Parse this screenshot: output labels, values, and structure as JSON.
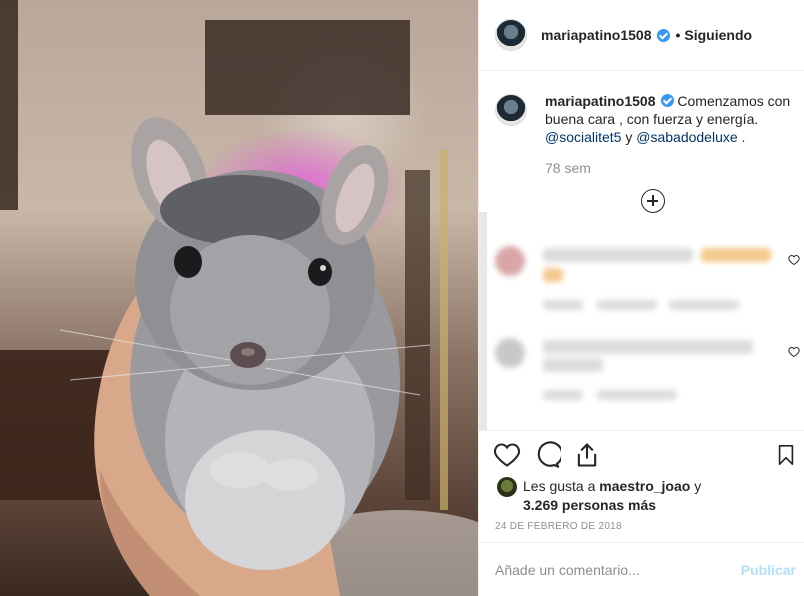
{
  "post": {
    "author": "mariapatino1508",
    "follow_separator": "•",
    "follow_status": "Siguiendo"
  },
  "caption": {
    "author": "mariapatino1508",
    "text_part1": "Comenzamos con buena cara , con fuerza y energía.",
    "mention1": "@socialitet5",
    "connector": " y ",
    "mention2": "@sabadodeluxe",
    "text_end": " .",
    "time_ago": "78 sem"
  },
  "likes": {
    "prefix": "Les gusta a ",
    "first_user": "maestro_joao",
    "connector": " y",
    "others": "3.269 personas más"
  },
  "date": "24 DE FEBRERO DE 2018",
  "comment_box": {
    "placeholder": "Añade un comentario...",
    "publish_label": "Publicar"
  },
  "icons": {
    "verified": "verified-badge-icon",
    "like": "heart-icon",
    "comment": "comment-bubble-icon",
    "share": "share-icon",
    "save": "bookmark-icon",
    "load_more": "plus-circle-icon"
  },
  "colors": {
    "verified_blue": "#3897f0",
    "mention": "#003569",
    "muted": "#8e8e8e",
    "publish_disabled": "#b2dffc"
  }
}
